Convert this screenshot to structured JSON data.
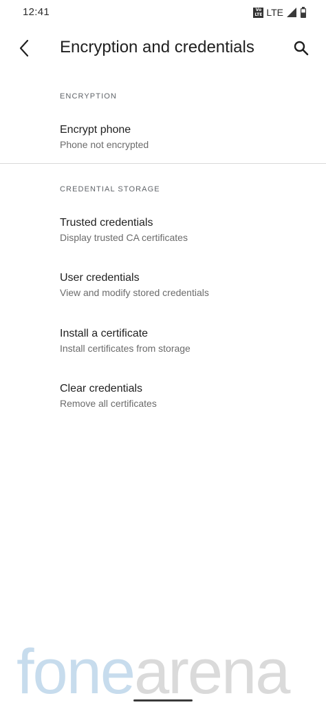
{
  "status_bar": {
    "time": "12:41",
    "volte_top": "Vo",
    "volte_bottom": "LTE",
    "network": "LTE",
    "icons": [
      "volte-icon",
      "signal-icon",
      "battery-icon"
    ]
  },
  "app_bar": {
    "title": "Encryption and credentials",
    "back_icon": "back-arrow-icon",
    "search_icon": "search-icon"
  },
  "sections": [
    {
      "header": "ENCRYPTION",
      "items": [
        {
          "title": "Encrypt phone",
          "summary": "Phone not encrypted"
        }
      ]
    },
    {
      "header": "CREDENTIAL STORAGE",
      "items": [
        {
          "title": "Trusted credentials",
          "summary": "Display trusted CA certificates"
        },
        {
          "title": "User credentials",
          "summary": "View and modify stored credentials"
        },
        {
          "title": "Install a certificate",
          "summary": "Install certificates from storage"
        },
        {
          "title": "Clear credentials",
          "summary": "Remove all certificates"
        }
      ]
    }
  ],
  "watermark": {
    "part1": "fone",
    "part2": "arena"
  },
  "colors": {
    "background": "#ffffff",
    "text_primary": "#1f1f1f",
    "text_secondary": "#6b6b6b",
    "divider": "#d9d9d9"
  }
}
